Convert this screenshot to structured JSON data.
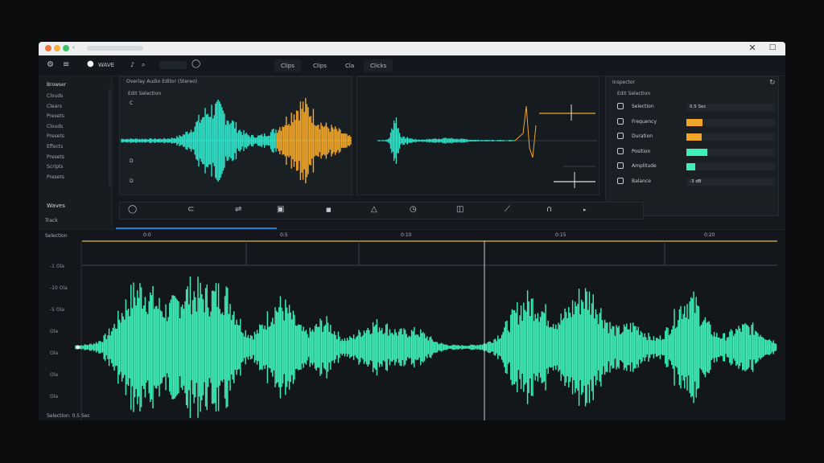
{
  "colors": {
    "accent_green": "#3ef0b8",
    "accent_orange": "#f0a52a",
    "accent_cyan": "#2fe3c8",
    "bg": "#15191d",
    "playhead": "#e8b83a"
  },
  "titlebar": {
    "url_text": "",
    "close_glyph": "✕",
    "maximize_glyph": "□"
  },
  "toolbar": {
    "project_name": "WAVE",
    "tabs": [
      {
        "label": "Clips"
      },
      {
        "label": "Clips"
      },
      {
        "label": "Cla"
      },
      {
        "label": "Clicks"
      }
    ]
  },
  "sidebar": {
    "header": "Browser",
    "items": [
      {
        "label": "Clouds"
      },
      {
        "label": "Clears"
      },
      {
        "label": "Presets"
      },
      {
        "label": "Clouds"
      },
      {
        "label": "Presets"
      },
      {
        "label": "Effects"
      },
      {
        "label": "Presets"
      },
      {
        "label": "Scripts"
      },
      {
        "label": "Presets"
      }
    ]
  },
  "editor": {
    "header": "Overlay  Audio  Editor (Stereo)",
    "sub_header": "Edit Selection",
    "left_labels": [
      "C",
      "D",
      "D"
    ]
  },
  "inspector": {
    "header": "Inspector",
    "subheader": "Edit Selection",
    "rows": [
      {
        "label": "Selection",
        "value": "0.5 Sec",
        "fill": 0
      },
      {
        "label": "Frequency",
        "value": "",
        "fill": 0.18
      },
      {
        "label": "Duration",
        "value": "",
        "fill": 0.17
      },
      {
        "label": "Position",
        "value": "",
        "fill": 0.24
      },
      {
        "label": "Amplitude",
        "value": "",
        "fill": 0.1
      },
      {
        "label": "Balance",
        "value": "-3 dB",
        "fill": 0
      }
    ]
  },
  "track": {
    "name": "Waves",
    "small_label": "Track",
    "sub_label": "Selection",
    "ruler_labels": [
      "0:0",
      "0:5",
      "0:10",
      "0:15",
      "0:20"
    ],
    "db_labels": [
      "-1 Ola",
      "-10 Ola",
      "-5 Ola",
      "Ola",
      "Ola",
      "Ola",
      "Ola"
    ],
    "footer": "Selection: 0.5 Sec"
  }
}
